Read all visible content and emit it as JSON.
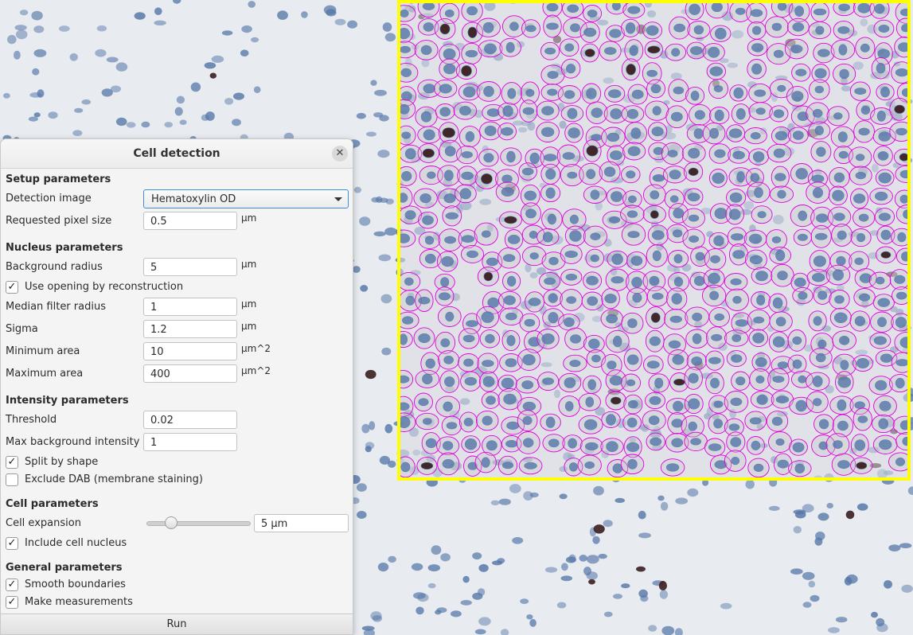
{
  "dialog": {
    "title": "Cell detection",
    "run_label": "Run",
    "setup": {
      "heading": "Setup parameters",
      "detection_image_label": "Detection image",
      "detection_image_value": "Hematoxylin OD",
      "pixel_size_label": "Requested pixel size",
      "pixel_size_value": "0.5",
      "pixel_size_unit": "µm"
    },
    "nucleus": {
      "heading": "Nucleus parameters",
      "background_radius_label": "Background radius",
      "background_radius_value": "5",
      "background_radius_unit": "µm",
      "opening_label": "Use opening by reconstruction",
      "opening_checked": true,
      "median_label": "Median filter radius",
      "median_value": "1",
      "median_unit": "µm",
      "sigma_label": "Sigma",
      "sigma_value": "1.2",
      "sigma_unit": "µm",
      "min_area_label": "Minimum area",
      "min_area_value": "10",
      "min_area_unit": "µm^2",
      "max_area_label": "Maximum area",
      "max_area_value": "400",
      "max_area_unit": "µm^2"
    },
    "intensity": {
      "heading": "Intensity parameters",
      "threshold_label": "Threshold",
      "threshold_value": "0.02",
      "max_bg_label": "Max background intensity",
      "max_bg_value": "1",
      "split_label": "Split by shape",
      "split_checked": true,
      "exclude_dab_label": "Exclude DAB (membrane staining)",
      "exclude_dab_checked": false
    },
    "cell": {
      "heading": "Cell parameters",
      "expansion_label": "Cell expansion",
      "expansion_value": "5 µm",
      "expansion_slider_fraction": 0.2,
      "include_nucleus_label": "Include cell nucleus",
      "include_nucleus_checked": true
    },
    "general": {
      "heading": "General parameters",
      "smooth_label": "Smooth boundaries",
      "smooth_checked": true,
      "measure_label": "Make measurements",
      "measure_checked": true
    }
  },
  "viewer": {
    "roi_color": "#ffff00",
    "cell_outline_color": "#e000e0",
    "nucleus_color": "#5577a8",
    "dab_nucleus_color": "#3a1e20",
    "tissue_background": "#e8ebf0"
  },
  "icons": {
    "close": "close-icon",
    "dropdown": "chevron-down-icon",
    "check": "check-icon"
  }
}
